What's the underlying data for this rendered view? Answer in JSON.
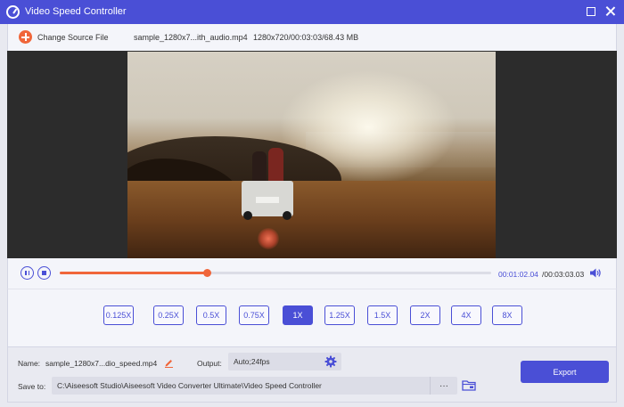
{
  "window": {
    "title": "Video Speed Controller"
  },
  "topbar": {
    "change_source_label": "Change Source File",
    "file_name": "sample_1280x7...ith_audio.mp4",
    "file_info": "1280x720/00:03:03/68.43 MB"
  },
  "player": {
    "current_time": "00:01:02.04",
    "total_time": "/00:03:03.03",
    "progress": 0.34
  },
  "speeds": [
    {
      "label": "0.125X",
      "active": false
    },
    {
      "label": "0.25X",
      "active": false
    },
    {
      "label": "0.5X",
      "active": false
    },
    {
      "label": "0.75X",
      "active": false
    },
    {
      "label": "1X",
      "active": true
    },
    {
      "label": "1.25X",
      "active": false
    },
    {
      "label": "1.5X",
      "active": false
    },
    {
      "label": "2X",
      "active": false
    },
    {
      "label": "4X",
      "active": false
    },
    {
      "label": "8X",
      "active": false
    }
  ],
  "output": {
    "name_label": "Name:",
    "name_value": "sample_1280x7...dio_speed.mp4",
    "output_label": "Output:",
    "output_value": "Auto;24fps",
    "save_label": "Save to:",
    "save_path": "C:\\Aiseesoft Studio\\Aiseesoft Video Converter Ultimate\\Video Speed Controller",
    "more_label": "···",
    "export_label": "Export"
  },
  "colors": {
    "accent": "#4a4fd6",
    "orange": "#f0663a"
  },
  "icons": [
    "app-logo-icon",
    "maximize-icon",
    "close-icon",
    "add-icon",
    "pause-icon",
    "stop-icon",
    "volume-icon",
    "edit-icon",
    "gear-icon",
    "folder-icon"
  ]
}
